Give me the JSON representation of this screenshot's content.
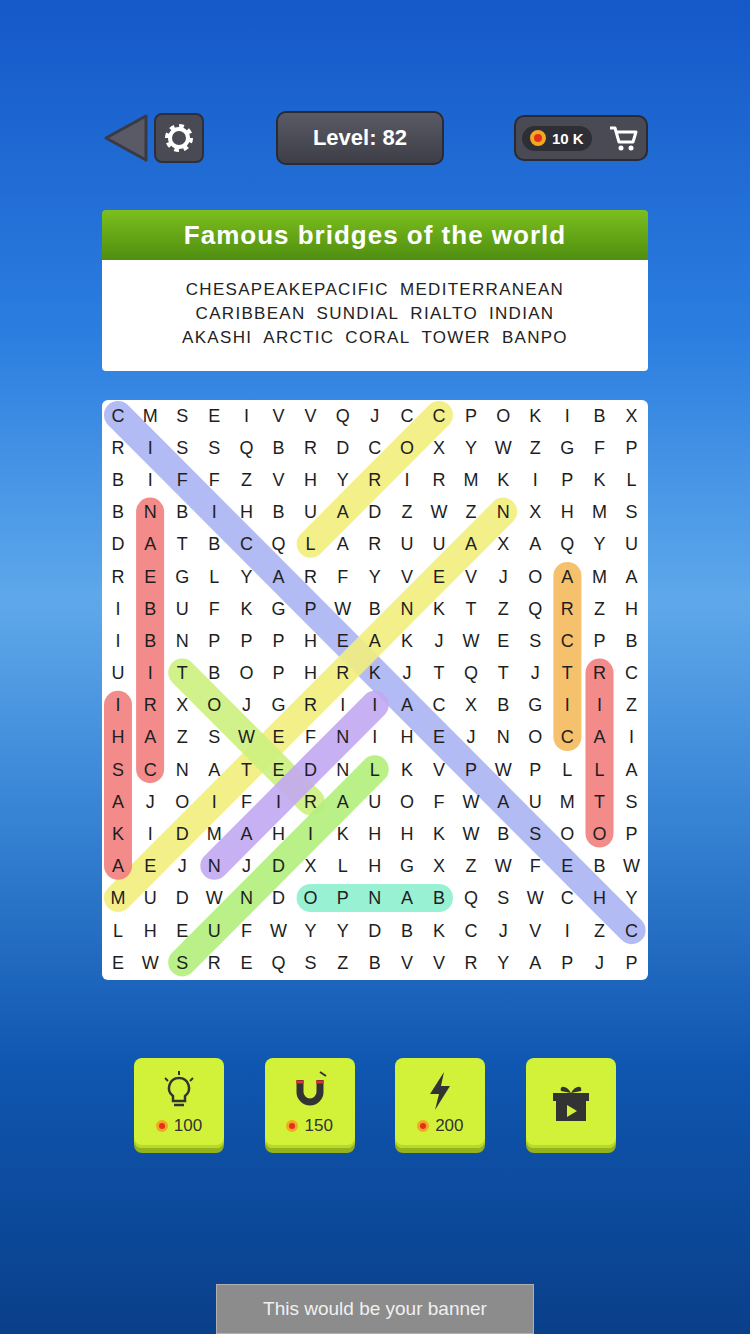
{
  "level": "Level: 82",
  "coins": "10 K",
  "title": "Famous bridges of the world",
  "word_rows": [
    [
      "CHESAPEAKEPACIFIC",
      "MEDITERRANEAN"
    ],
    [
      "CARIBBEAN",
      "SUNDIAL",
      "RIALTO",
      "INDIAN"
    ],
    [
      "AKASHI",
      "ARCTIC",
      "CORAL",
      "TOWER",
      "BANPO"
    ]
  ],
  "grid": [
    "CMSEIVVQJCCPOKIBX",
    "RISSQBRDCOXYWZGFP",
    "BIFFZVHYRIRMKIPKL",
    "BNBIHBUADZWZNXHMS",
    "DATBCQLARUUAXAQYU",
    "REGLYARFYVEVJOAMA",
    "IBUFKGPWBNKTZQRZH",
    "IBNPPPHEAKJWESCPB",
    "UITBOPHRKJTQTJTRC",
    "IRXOJGRIIACXBGIIZ",
    "HAZSWEFNIHEJNOCAI",
    "SCNATEDNLKVPWPLLA",
    "AJOIFIRAUOFWAUMTS",
    "KIDMAHIKHHKWBSOOP",
    "AEJNJDXLHGXZWFEBW",
    "MUDWNDOPNABQSWCHY",
    "LHEUFWYYDBKCJVIZC",
    "EWSREQSZBVVRYAPJP"
  ],
  "highlights": [
    {
      "word": "CHESAPEAKEPACIFIC",
      "from": [
        16,
        16
      ],
      "to": [
        0,
        0
      ],
      "color": "#aab4f2"
    },
    {
      "word": "CORAL",
      "from": [
        0,
        10
      ],
      "to": [
        4,
        6
      ],
      "color": "#f2ef7e"
    },
    {
      "word": "MEDITERRANEAN",
      "from": [
        15,
        0
      ],
      "to": [
        3,
        12
      ],
      "color": "#f2ef7e"
    },
    {
      "word": "CARIBBEAN",
      "from": [
        11,
        1
      ],
      "to": [
        3,
        1
      ],
      "color": "#f27f7f"
    },
    {
      "word": "AKASHI",
      "from": [
        14,
        0
      ],
      "to": [
        9,
        0
      ],
      "color": "#f27f7f"
    },
    {
      "word": "ARCTIC",
      "from": [
        5,
        14
      ],
      "to": [
        10,
        14
      ],
      "color": "#f5bb5e"
    },
    {
      "word": "RIALTO",
      "from": [
        8,
        15
      ],
      "to": [
        13,
        15
      ],
      "color": "#f27f7f"
    },
    {
      "word": "BANPO",
      "from": [
        15,
        10
      ],
      "to": [
        15,
        6
      ],
      "color": "#8ef0cf"
    },
    {
      "word": "TOWER",
      "from": [
        8,
        2
      ],
      "to": [
        12,
        6
      ],
      "color": "#cdf07e"
    },
    {
      "word": "SUNDIAL",
      "from": [
        17,
        2
      ],
      "to": [
        11,
        8
      ],
      "color": "#b2ef7c"
    },
    {
      "word": "INDIAN",
      "from": [
        9,
        8
      ],
      "to": [
        14,
        3
      ],
      "color": "#c3a9f2"
    }
  ],
  "tools": [
    {
      "kind": "hint",
      "cost": "100"
    },
    {
      "kind": "magnet",
      "cost": "150"
    },
    {
      "kind": "bolt",
      "cost": "200"
    },
    {
      "kind": "video"
    }
  ],
  "banner": "This would be your banner"
}
